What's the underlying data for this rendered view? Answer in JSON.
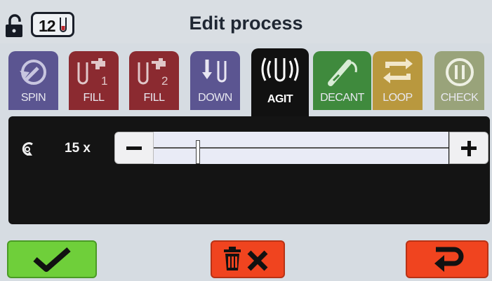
{
  "header": {
    "title": "Edit process",
    "tube_count": "12",
    "lock_icon": "unlocked-padlock-icon",
    "tube_icon": "test-tube-icon"
  },
  "tabs": [
    {
      "label": "SPIN",
      "icon": "spin-icon",
      "active": false
    },
    {
      "label": "FILL",
      "icon": "fill-1-tap-icon",
      "active": false
    },
    {
      "label": "FILL",
      "icon": "fill-2-tap-icon",
      "active": false
    },
    {
      "label": "DOWN",
      "icon": "down-arrows-icon",
      "active": false
    },
    {
      "label": "AGIT",
      "icon": "agitate-icon",
      "active": true
    },
    {
      "label": "DECANT",
      "icon": "decant-icon",
      "active": false
    },
    {
      "label": "LOOP",
      "icon": "loop-icon",
      "active": false
    },
    {
      "label": "CHECK",
      "icon": "pause-check-icon",
      "active": false
    }
  ],
  "agitation": {
    "repeat_icon": "repeat-count-icon",
    "value_text": "15 x",
    "slider_fraction": 0.15
  },
  "buttons": {
    "confirm": "checkmark-icon",
    "delete": "trash-x-icon",
    "back": "return-arrow-icon"
  },
  "colors": {
    "spin": "#5b5591",
    "fill": "#8b2a30",
    "down": "#5b5591",
    "agit": "#111111",
    "decant": "#3f8a3d",
    "loop": "#b9983e",
    "check": "#99a37a",
    "confirm": "#6fcf3a",
    "danger": "#f0441f"
  }
}
